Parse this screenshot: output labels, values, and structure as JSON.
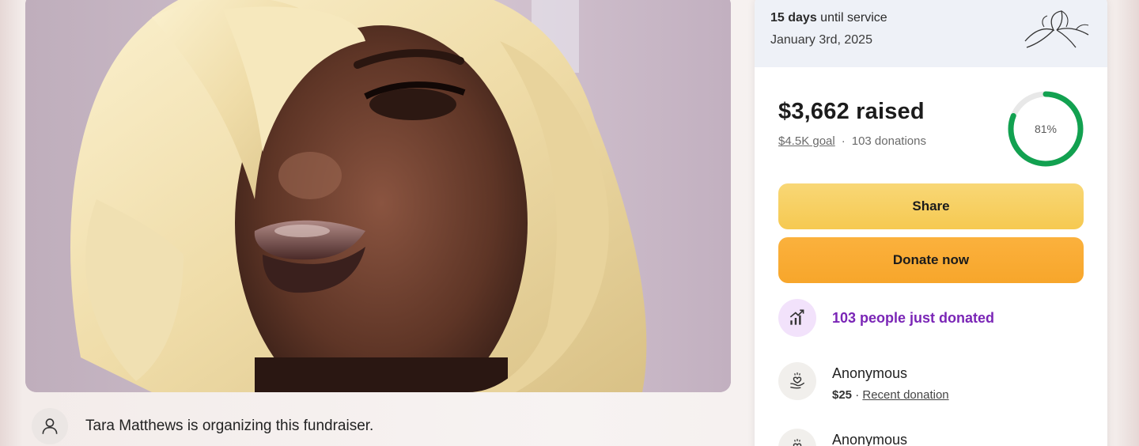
{
  "photo": {
    "alt": "fundraiser-photo"
  },
  "organizer": {
    "text": "Tara Matthews is organizing this fundraiser."
  },
  "service": {
    "days_count": "15 days",
    "days_suffix": " until service",
    "date": "January 3rd, 2025"
  },
  "progress": {
    "raised": "$3,662 raised",
    "goal": "$4.5K goal",
    "separator": "·",
    "donations": "103 donations",
    "percent_label": "81%",
    "percent_value": 81,
    "ring_color": "#12a150",
    "track_color": "#e8e8e8"
  },
  "buttons": {
    "share": "Share",
    "donate": "Donate now"
  },
  "momentum": {
    "text": "103 people just donated"
  },
  "donors": [
    {
      "name": "Anonymous",
      "amount": "$25",
      "separator": " · ",
      "tag": "Recent donation"
    },
    {
      "name": "Anonymous"
    }
  ],
  "colors": {
    "share_button": "#f6c951",
    "donate_button": "#f7a62b",
    "momentum_text": "#7a25b6",
    "banner_bg": "#eef1f7"
  }
}
